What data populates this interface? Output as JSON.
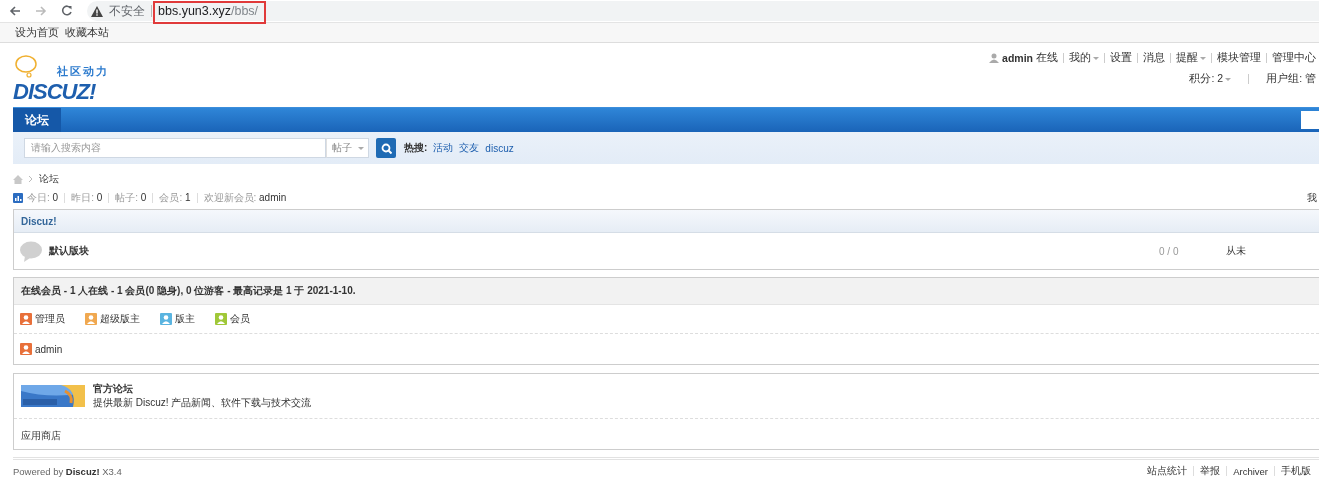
{
  "browser": {
    "security": "不安全",
    "url_host": "bbs.yun3.xyz",
    "url_path": "/bbs/"
  },
  "topbar": {
    "links": [
      "设为首页",
      "收藏本站"
    ]
  },
  "logo": {
    "tagline": "社区动力",
    "wordmark": "DISCUZ!"
  },
  "user_menu": {
    "username": "admin",
    "status": "在线",
    "items": [
      {
        "label": "我的",
        "dropdown": true
      },
      {
        "label": "设置",
        "dropdown": false
      },
      {
        "label": "消息",
        "dropdown": false
      },
      {
        "label": "提醒",
        "dropdown": true
      },
      {
        "label": "模块管理",
        "dropdown": false
      },
      {
        "label": "管理中心",
        "dropdown": false
      }
    ],
    "points": "积分: 2",
    "usergroup": "用户组: 管"
  },
  "nav": {
    "tabs": [
      {
        "label": "论坛",
        "selected": true
      }
    ]
  },
  "search": {
    "placeholder": "请输入搜索内容",
    "scope": "帖子",
    "hot_label": "热搜:",
    "hot": [
      "活动",
      "交友",
      "discuz"
    ]
  },
  "breadcrumb": [
    "论坛"
  ],
  "stats": [
    {
      "label": "今日:",
      "value": "0"
    },
    {
      "label": "昨日:",
      "value": "0"
    },
    {
      "label": "帖子:",
      "value": "0"
    },
    {
      "label": "会员:",
      "value": "1"
    },
    {
      "label": "欢迎新会员:",
      "value": "admin"
    }
  ],
  "stats_right": "我",
  "category": {
    "title": "Discuz!",
    "forums": [
      {
        "name": "默认版块",
        "counts": "0 / 0",
        "last_post": "从未"
      }
    ]
  },
  "online": {
    "summary": "在线会员 - 1 人在线 - 1 会员(0 隐身), 0 位游客 - 最高记录是 1 于 2021-1-10.",
    "legend": [
      {
        "label": "管理员",
        "color": "#e8703a"
      },
      {
        "label": "超级版主",
        "color": "#f0a850"
      },
      {
        "label": "版主",
        "color": "#5ab4e0"
      },
      {
        "label": "会员",
        "color": "#a0c838"
      }
    ],
    "members": [
      {
        "name": "admin",
        "color": "#e8703a"
      }
    ]
  },
  "links": {
    "items": [
      {
        "title": "官方论坛",
        "description": "提供最新 Discuz! 产品新闻、软件下载与技术交流"
      }
    ],
    "text_links": [
      "应用商店"
    ]
  },
  "footer": {
    "powered": "Powered by **Discuz!** X3.4",
    "links": [
      "站点统计",
      "举报",
      "Archiver",
      "手机版"
    ]
  }
}
